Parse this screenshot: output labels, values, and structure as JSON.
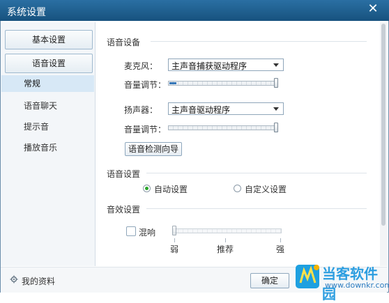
{
  "window": {
    "title": "系统设置",
    "close_glyph": "✕"
  },
  "sidebar": {
    "buttons": [
      "基本设置",
      "语音设置"
    ],
    "items": [
      "常规",
      "语音聊天",
      "提示音",
      "播放音乐"
    ],
    "active_item": "常规"
  },
  "voice_device": {
    "section_title": "语音设备",
    "mic_label": "麦克风：",
    "mic_value": "主声音捕获驱动程序",
    "mic_volume_label": "音量调节：",
    "mic_volume": 0.08,
    "speaker_label": "扬声器：",
    "speaker_value": "主声音驱动程序",
    "speaker_volume_label": "音量调节：",
    "speaker_volume": 0.0,
    "wizard_button": "语音检测向导"
  },
  "voice_settings": {
    "section_title": "语音设置",
    "auto_label": "自动设置",
    "custom_label": "自定义设置",
    "selected": "auto"
  },
  "effects": {
    "section_title": "音效设置",
    "reverb_label": "混响",
    "reverb_checked": false,
    "scale": {
      "weak": "弱",
      "recommended": "推荐",
      "strong": "强"
    }
  },
  "footer": {
    "profile_label": "我的资料",
    "ok_button": "确定"
  },
  "watermark": {
    "brand": "当客软件园",
    "url": "www.downkr.com"
  },
  "colors": {
    "titlebar": "#1f5f8f",
    "accent": "#3576b8",
    "radio_dot": "#2aa52a",
    "sidebar_active": "#d7e8f6"
  },
  "icons": {
    "close": "close-icon",
    "dropdown": "chevron-down-icon",
    "profile": "gear-icon"
  }
}
